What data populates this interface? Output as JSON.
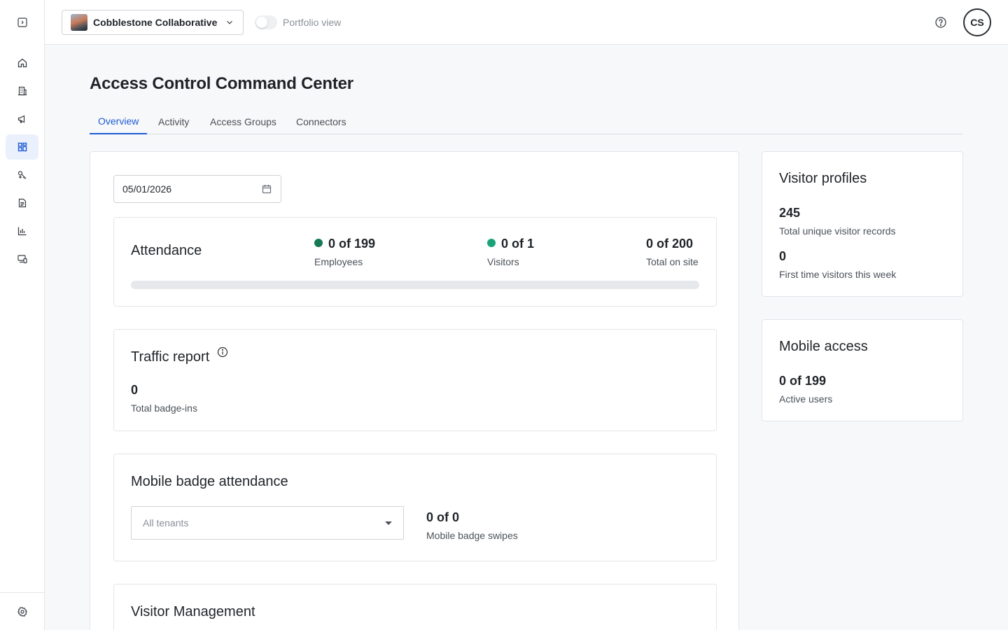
{
  "sidebar": {
    "collapse_icon": "sidebar-expand-icon",
    "items": [
      {
        "name": "home",
        "icon": "home-icon"
      },
      {
        "name": "buildings",
        "icon": "building-icon"
      },
      {
        "name": "announcements",
        "icon": "megaphone-icon"
      },
      {
        "name": "dashboard",
        "icon": "dashboard-icon",
        "active": true
      },
      {
        "name": "access",
        "icon": "key-icon"
      },
      {
        "name": "documents",
        "icon": "document-icon"
      },
      {
        "name": "reports",
        "icon": "bar-chart-icon"
      },
      {
        "name": "devices",
        "icon": "devices-icon"
      }
    ],
    "settings_icon": "gear-icon"
  },
  "header": {
    "property_name": "Cobblestone Collaborative",
    "portfolio_toggle_label": "Portfolio view",
    "portfolio_toggle_on": false,
    "avatar_initials": "CS"
  },
  "page": {
    "title": "Access Control Command Center",
    "tabs": [
      {
        "label": "Overview",
        "active": true
      },
      {
        "label": "Activity",
        "active": false
      },
      {
        "label": "Access Groups",
        "active": false
      },
      {
        "label": "Connectors",
        "active": false
      }
    ]
  },
  "date_picker": {
    "value": "05/01/2026"
  },
  "attendance": {
    "title": "Attendance",
    "employees": {
      "value": "0 of 199",
      "label": "Employees",
      "color": "#157a53"
    },
    "visitors": {
      "value": "0 of 1",
      "label": "Visitors",
      "color": "#1aa37a"
    },
    "total": {
      "value": "0 of 200",
      "label": "Total on site"
    },
    "progress_fraction": 0
  },
  "traffic": {
    "title": "Traffic report",
    "value": "0",
    "label": "Total badge-ins"
  },
  "mobile_badge": {
    "title": "Mobile badge attendance",
    "tenant_placeholder": "All tenants",
    "value": "0 of 0",
    "label": "Mobile badge swipes"
  },
  "visitor_management": {
    "title": "Visitor Management"
  },
  "visitor_profiles": {
    "title": "Visitor profiles",
    "total_value": "245",
    "total_label": "Total unique visitor records",
    "first_time_value": "0",
    "first_time_label": "First time visitors this week"
  },
  "mobile_access": {
    "title": "Mobile access",
    "value": "0 of 199",
    "label": "Active users"
  },
  "colors": {
    "accent": "#1e5bd6",
    "active_nav_bg": "#ebf1fc"
  }
}
